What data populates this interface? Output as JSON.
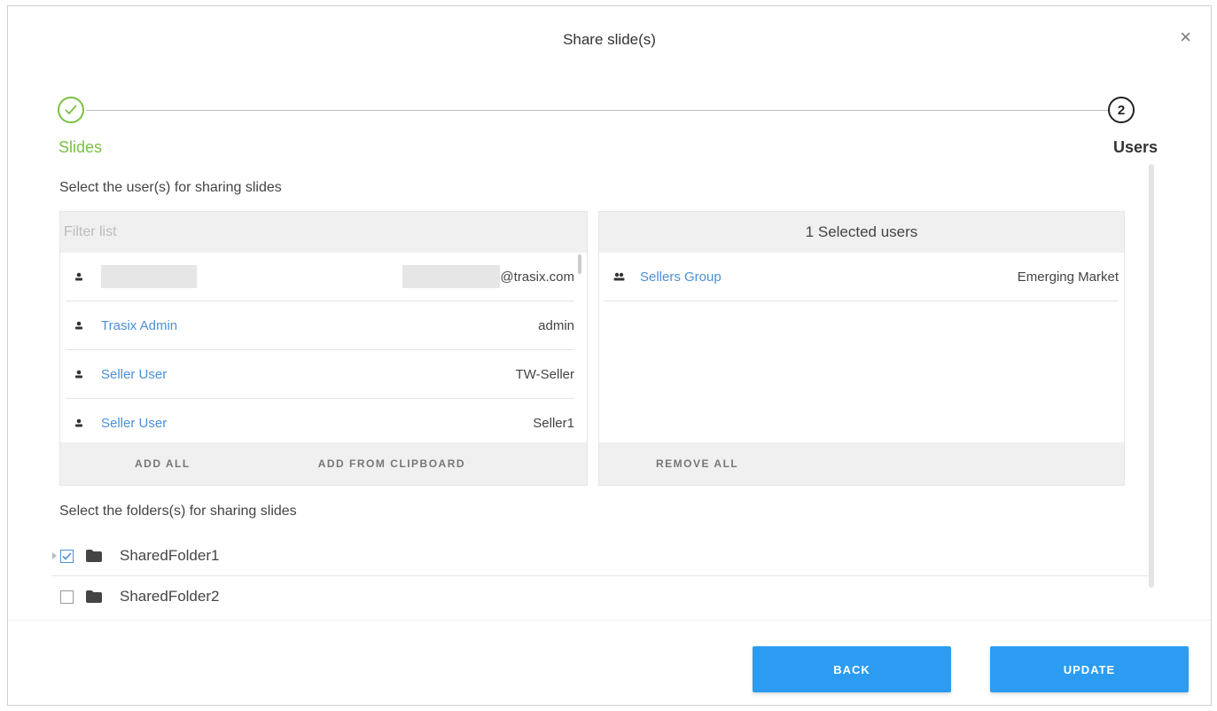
{
  "dialog": {
    "title": "Share slide(s)",
    "close_symbol": "×"
  },
  "stepper": {
    "step1_label": "Slides",
    "step2_number": "2",
    "step2_label": "Users"
  },
  "users_section": {
    "label": "Select the user(s) for sharing slides",
    "filter_placeholder": "Filter list",
    "available": [
      {
        "name": "",
        "login": "@trasix.com",
        "redacted": true
      },
      {
        "name": "Trasix Admin",
        "login": "admin"
      },
      {
        "name": "Seller User",
        "login": "TW-Seller"
      },
      {
        "name": "Seller User",
        "login": "Seller1"
      }
    ],
    "add_all_label": "ADD ALL",
    "add_clipboard_label": "ADD FROM CLIPBOARD",
    "selected_header": "1 Selected users",
    "selected": [
      {
        "name": "Sellers Group",
        "group": "Emerging Market"
      }
    ],
    "remove_all_label": "REMOVE ALL"
  },
  "folders_section": {
    "label": "Select the folders(s) for sharing slides",
    "folders": [
      {
        "name": "SharedFolder1",
        "checked": true
      },
      {
        "name": "SharedFolder2",
        "checked": false
      }
    ]
  },
  "actions": {
    "back_label": "BACK",
    "update_label": "UPDATE"
  },
  "colors": {
    "accent_blue": "#2b9cf2",
    "link_blue": "#4a90d9",
    "success_green": "#7ac142"
  }
}
